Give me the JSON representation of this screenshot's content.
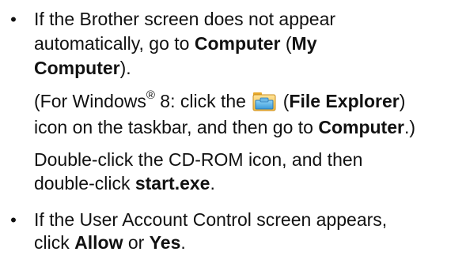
{
  "bullets": [
    {
      "bullet_char": "•",
      "line1": "If the Brother screen does not appear",
      "line2_pre": "automatically, go to ",
      "line2_bold": "Computer",
      "line2_mid": " (",
      "line2_bold2": "My",
      "line3_bold": "Computer",
      "line3_post": ").",
      "para2_line1_pre": "(For Windows",
      "para2_reg": "®",
      "para2_line1_mid": " 8: click the ",
      "para2_line1_post_open": " (",
      "para2_line1_bold": "File Explorer",
      "para2_line1_close": ")",
      "para2_line2_pre": "icon on the taskbar, and then go to ",
      "para2_line2_bold": "Computer",
      "para2_line2_post": ".)",
      "para3_line1": "Double-click the CD-ROM icon, and then",
      "para3_line2_pre": "double-click ",
      "para3_line2_bold": "start.exe",
      "para3_line2_post": "."
    },
    {
      "bullet_char": "•",
      "line1": "If the User Account Control screen appears,",
      "line2_pre": "click ",
      "line2_bold": "Allow",
      "line2_mid": " or ",
      "line2_bold2": "Yes",
      "line2_post": "."
    }
  ],
  "icons": {
    "file_explorer_icon": "folder-icon"
  }
}
